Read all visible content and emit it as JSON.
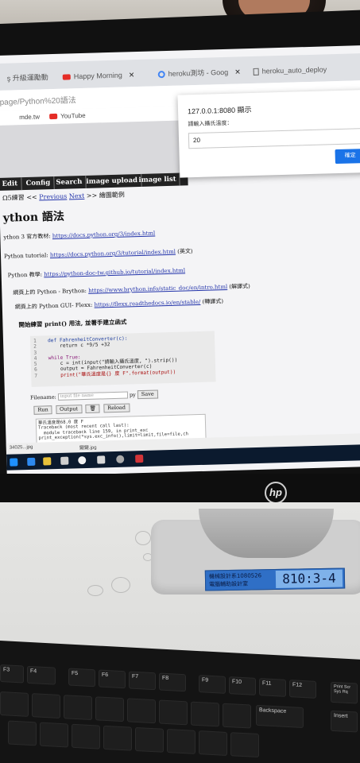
{
  "browser": {
    "tabs": [
      {
        "label": "ş 升級運勵動",
        "icon": "page-icon"
      },
      {
        "label": "Happy Morning",
        "icon": "youtube-icon"
      },
      {
        "label": "heroku測坊 - Goog",
        "icon": "google-icon"
      },
      {
        "label": "heroku_auto_deploy",
        "icon": "document-icon"
      }
    ],
    "address": "page/Python%20語法",
    "bookmarks": [
      "mde.tw",
      "YouTube"
    ]
  },
  "dialog": {
    "title": "127.0.0.1:8080 顯示",
    "message": "請輸入攝氏溫度：",
    "input_value": "20",
    "ok_label": "確定"
  },
  "nav": {
    "items": [
      "Edit",
      "Config",
      "Search",
      "image upload",
      "image list"
    ]
  },
  "page": {
    "breadcrumb_lead": "Ω5練習 <<",
    "previous_label": "Previous",
    "next_label": "Next",
    "breadcrumb_tail": ">> 繪圖範例",
    "title": "ython 語法",
    "lines": [
      {
        "pre": "ython 3 官方教材: ",
        "link": "https://docs.python.org/3/index.html",
        "post": ""
      },
      {
        "pre": "Python tutorial: ",
        "link": "https://docs.python.org/3/tutorial/index.html",
        "post": " (英文)"
      },
      {
        "pre": "Python 教學: ",
        "link": "https://python-doc-tw.github.io/tutorial/index.html",
        "post": ""
      },
      {
        "pre": "網頁上的 Python - Brython: ",
        "link": "https://www.brython.info/static_doc/en/intro.html",
        "post": " (解譯式)"
      },
      {
        "pre": "網頁上的 Python GUI- Flexx: ",
        "link": "https://flexx.readthedocs.io/en/stable/",
        "post": " (轉譯式)"
      }
    ],
    "subheading": "開始練習 print() 用法, 並著手建立函式"
  },
  "editor": {
    "code_lines": [
      {
        "n": "1",
        "text": "def FahrenheitConverter(c):"
      },
      {
        "n": "2",
        "text": "    return c *9/5 +32"
      },
      {
        "n": "3",
        "text": ""
      },
      {
        "n": "4",
        "text": "while True:"
      },
      {
        "n": "5",
        "text": "    c = int(input(\"請輸入攝氏溫度, \").strip())"
      },
      {
        "n": "6",
        "text": "    output = FahrenheitConverter(c)"
      },
      {
        "n": "7",
        "text": "    print(\"華氏溫度是{} 度 F\".format(output))"
      }
    ]
  },
  "controls": {
    "filename_label": "Filename:",
    "filename_placeholder": "input file name",
    "ext": "py",
    "save_label": "Save",
    "run_label": "Run",
    "output_label": "Output",
    "clear_icon": "trash-icon",
    "reload_label": "Reload"
  },
  "output": {
    "lines": [
      "華氏溫度是68.0 度 F",
      "Traceback (most recent call last):",
      "  module traceback line 159, in print_exc",
      "",
      "print_exception(*sys.exc_info(),limit=limit,file=file,ch"
    ]
  },
  "downloads": {
    "item1": "34025...jpg",
    "item2": "鍵鍵.jpg"
  },
  "monitor": {
    "brand": "hp"
  },
  "sticker": {
    "line1": "機械設計系1080526",
    "line2": "電腦輔助設計室",
    "code": "810:3-4"
  },
  "keyboard": {
    "keys": [
      "F3",
      "F4",
      "F5",
      "F6",
      "F7",
      "F8",
      "F9",
      "F10",
      "F11",
      "F12",
      "Print Scr Sys Rq",
      "Backspace",
      "Insert"
    ]
  },
  "colors": {
    "dialog_button": "#1a73e8",
    "sticker_blue": "#2f6fc6",
    "link": "#2233aa"
  }
}
